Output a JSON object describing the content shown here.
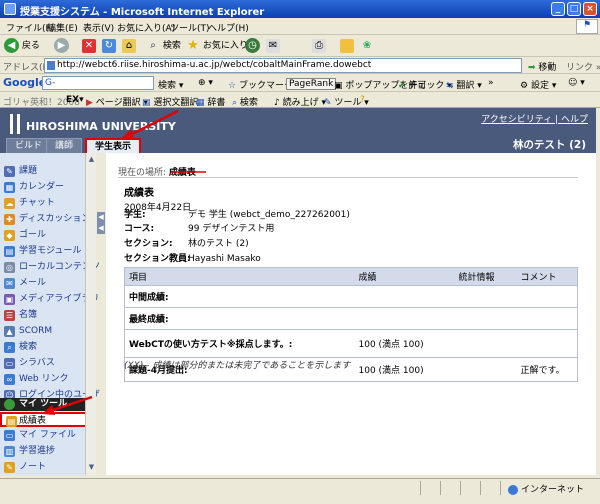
{
  "window": {
    "title": "授業支援システム - Microsoft Internet Explorer",
    "minimize": "_",
    "maximize": "□",
    "close": "×"
  },
  "menu": [
    "ファイル(F)",
    "編集(E)",
    "表示(V)",
    "お気に入り(A)",
    "ツール(T)",
    "ヘルプ(H)"
  ],
  "toolbar": {
    "back": "戻る",
    "search": "検索",
    "favorites": "お気に入り"
  },
  "address": {
    "label": "アドレス(D)",
    "url": "http://webct6.riise.hiroshima-u.ac.jp/webct/cobaltMainFrame.dowebct",
    "go": "移動",
    "links": "リンク »"
  },
  "google": {
    "logo": "Google",
    "prefix": "G-",
    "search": "検索",
    "bookmarks": "ブックマーク",
    "pagerank": "PageRank",
    "popup": "ポップアップを許可",
    "check": "チェック",
    "translate": "翻訳",
    "more": "»",
    "settings": "設定"
  },
  "translatebar": {
    "brand": "ゴリャ英和！2008",
    "ex": "EX",
    "page": "ページ翻訳",
    "selected": "選択文翻訳",
    "dict": "辞書",
    "search": "検索",
    "read": "読み上げ",
    "tools": "ツール"
  },
  "header": {
    "university": "HIROSHIMA UNIVERSITY",
    "links": "アクセシビリティ | ヘルプ",
    "course": "林のテスト (2)",
    "tabs": [
      "ビルド",
      "講師",
      "学生表示"
    ]
  },
  "sidebar": {
    "items": [
      "課題",
      "カレンダー",
      "チャット",
      "ディスカッション",
      "ゴール",
      "学習モジュール",
      "ローカルコンテンツ",
      "メール",
      "メディアライブラリ",
      "名簿",
      "SCORM",
      "検索",
      "シラバス",
      "Web リンク",
      "ログイン中のユーザ"
    ],
    "mytools_header": "マイ ツール",
    "mytools": [
      "成績表",
      "マイ ファイル",
      "学習進捗",
      "ノート"
    ]
  },
  "content": {
    "breadcrumb_label": "現在の場所:",
    "breadcrumb_current": "成績表",
    "title": "成績表",
    "date": "2008年4月22日",
    "student_label": "学生:",
    "student_value": "デモ 学生 (webct_demo_227262001)",
    "course_label": "コース:",
    "course_value": "99 デザインテスト用",
    "section_label": "セクション:",
    "section_value": "林のテスト (2)",
    "instructor_label": "セクション教員:",
    "instructor_value": "Hayashi Masako",
    "table": {
      "headers": [
        "項目",
        "成績",
        "統計情報",
        "コメント"
      ],
      "rows": [
        {
          "item": "中間成績:",
          "grade": "",
          "stats": "",
          "comment": ""
        },
        {
          "item": "最終成績:",
          "grade": "",
          "stats": "",
          "comment": ""
        },
        {
          "item": "WebCTの使い方テスト※採点します。:",
          "grade": "100 (満点 100)",
          "stats": "",
          "comment": ""
        },
        {
          "item": "課題-4月提出:",
          "grade": "100 (満点 100)",
          "stats": "",
          "comment": "正解です。"
        }
      ]
    },
    "footnote": "(XX) - 成績は部分的または未完了であることを示します"
  },
  "status": {
    "zone": "インターネット"
  },
  "colors": {
    "header_bg": "#4a5a7c",
    "sidebar_bg": "#dbe4f3",
    "highlight": "#e00000",
    "table_header": "#d3dbea"
  }
}
